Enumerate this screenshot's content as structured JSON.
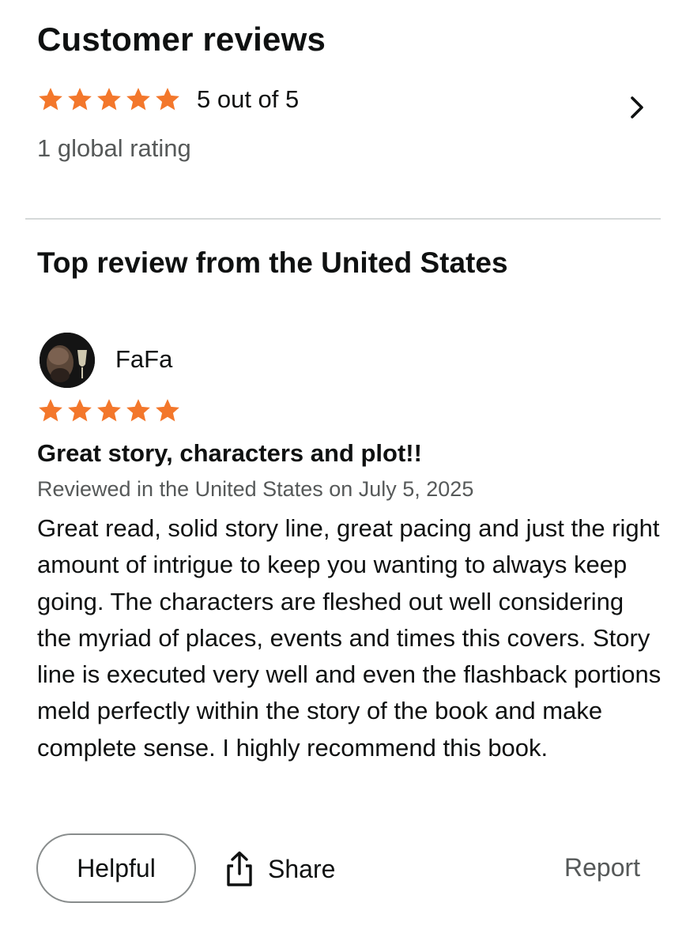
{
  "summary": {
    "title": "Customer reviews",
    "rating_text": "5 out of 5",
    "stars": 5,
    "global_rating": "1 global rating",
    "chevron_icon": "chevron-right-icon"
  },
  "top_review": {
    "section_title": "Top review from the United States",
    "reviewer_name": "FaFa",
    "stars": 5,
    "title": "Great story, characters and plot!!",
    "meta": "Reviewed in the United States on July 5, 2025",
    "body": "Great read, solid story line, great pacing and just the right amount of intrigue to keep you wanting to always keep going. The characters are fleshed out well considering the myriad of places, events and times this covers. Story line is executed very well and even the flashback portions meld perfectly within the story of the book and make complete sense. I highly recommend this book."
  },
  "actions": {
    "helpful_label": "Helpful",
    "share_label": "Share",
    "share_icon": "share-icon",
    "report_label": "Report"
  },
  "colors": {
    "star": "#f3772b",
    "text": "#0f1111",
    "muted": "#565959",
    "divider": "#d5d9d9"
  }
}
